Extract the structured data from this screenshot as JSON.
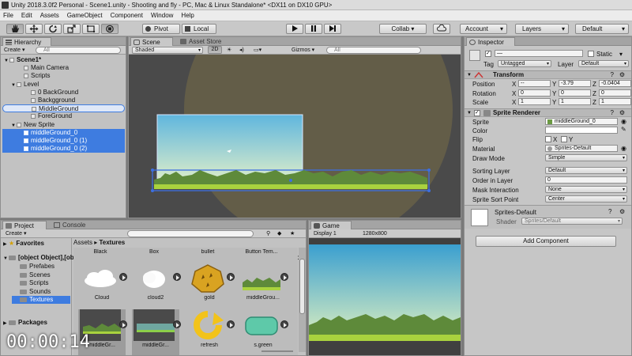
{
  "window": {
    "title": "Unity 2018.3.0f2 Personal - Scene1.unity - Shooting and fly - PC, Mac & Linux Standalone* <DX11 on DX10 GPU>"
  },
  "menu": [
    "File",
    "Edit",
    "Assets",
    "GameObject",
    "Component",
    "Window",
    "Help"
  ],
  "toolbar": {
    "pivot": "Pivot",
    "local": "Local",
    "collab": "Collab ▾",
    "account": "Account",
    "layers": "Layers",
    "layout": "Default"
  },
  "hierarchy": {
    "tab": "Hierarchy",
    "create": "Create ▾",
    "search_placeholder": "All",
    "rows": [
      {
        "label": "Scene1*",
        "depth": 0,
        "arrow": "▼",
        "icon": "scene",
        "selected": false,
        "bold": true
      },
      {
        "label": "Main Camera",
        "depth": 2,
        "arrow": "",
        "icon": "cube",
        "selected": false
      },
      {
        "label": "Scripts",
        "depth": 2,
        "arrow": "",
        "icon": "cube",
        "selected": false
      },
      {
        "label": "Level",
        "depth": 1,
        "arrow": "▼",
        "icon": "cube",
        "selected": false
      },
      {
        "label": "0 BackGround",
        "depth": 3,
        "arrow": "",
        "icon": "cube",
        "selected": false
      },
      {
        "label": "Backgground",
        "depth": 3,
        "arrow": "",
        "icon": "cube",
        "selected": false
      },
      {
        "label": "MiddleGround",
        "depth": 3,
        "arrow": "",
        "icon": "cube",
        "selected": false,
        "outlined": true
      },
      {
        "label": "ForeGround",
        "depth": 3,
        "arrow": "",
        "icon": "cube",
        "selected": false
      },
      {
        "label": "New Sprite",
        "depth": 1,
        "arrow": "▼",
        "icon": "cube",
        "selected": false
      },
      {
        "label": "middleGround_0",
        "depth": 2,
        "arrow": "",
        "icon": "cube",
        "selected": true
      },
      {
        "label": "middleGround_0 (1)",
        "depth": 2,
        "arrow": "",
        "icon": "cube",
        "selected": true
      },
      {
        "label": "middleGround_0 (2)",
        "depth": 2,
        "arrow": "",
        "icon": "cube",
        "selected": true
      }
    ]
  },
  "scene": {
    "tabs": [
      "Scene",
      "Asset Store"
    ],
    "shading": "Shaded",
    "mode2d": "2D",
    "gizmos": "Gizmos ▾",
    "search_placeholder": "All"
  },
  "project": {
    "tabs": [
      "Project",
      "Console"
    ],
    "create": "Create ▾",
    "favorites": "Favorites",
    "assets": [
      {
        "label": "Cloud",
        "kind": "cloud"
      },
      {
        "label": "cloud2",
        "kind": "cloud2"
      },
      {
        "label": "gold",
        "kind": "gold"
      },
      {
        "label": "middleGrou...",
        "kind": "ground"
      },
      {
        "label": "middleGr...",
        "kind": "strip"
      },
      {
        "label": "middleGr...",
        "kind": "strip2"
      },
      {
        "label": "refresh",
        "kind": "refresh"
      },
      {
        "label": "s.green",
        "kind": "green"
      }
    ],
    "packages": "Packages",
    "folders": [
      "Prefabes",
      "Scenes",
      "Scripts",
      "Sounds",
      "Textures"
    ],
    "breadcrumb": [
      "Assets",
      "Textures"
    ],
    "top_labels": [
      "Black",
      "Box",
      "bullet",
      "Button Tem..."
    ]
  },
  "game": {
    "tab": "Game",
    "display": "Display 1",
    "resolution": "1280x800"
  },
  "inspector": {
    "tab": "Inspector",
    "static": "Static",
    "tag_label": "Tag",
    "tag": "Untagged",
    "layer_label": "Layer",
    "layer": "Default",
    "transform": {
      "title": "Transform",
      "rows": [
        {
          "label": "Position",
          "x": "--",
          "y": "-3.79",
          "z": "-0.0404"
        },
        {
          "label": "Rotation",
          "x": "0",
          "y": "0",
          "z": "0"
        },
        {
          "label": "Scale",
          "x": "1",
          "y": "1",
          "z": "1"
        }
      ]
    },
    "sprite_renderer": {
      "title": "Sprite Renderer",
      "sprite_label": "Sprite",
      "sprite": "middleGround_0",
      "color_label": "Color",
      "flip_label": "Flip",
      "flip_x": "X",
      "flip_y": "Y",
      "material_label": "Material",
      "material": "Sprites-Default",
      "draw_mode_label": "Draw Mode",
      "draw_mode": "Simple",
      "sorting_layer_label": "Sorting Layer",
      "sorting_layer": "Default",
      "order_label": "Order in Layer",
      "order": "0",
      "mask_label": "Mask Interaction",
      "mask": "None",
      "sort_point_label": "Sprite Sort Point",
      "sort_point": "Center"
    },
    "material": {
      "name": "Sprites-Default",
      "shader_label": "Shader",
      "shader": "Sprites/Default"
    },
    "add_component": "Add Component"
  },
  "overlay": {
    "timestamp": "00:00:14"
  },
  "colors": {
    "selection": "#3e7ce0",
    "sky_top": "#5fb6de",
    "sky_bottom": "#e8f2c8",
    "grass": "#6e9a3c"
  }
}
